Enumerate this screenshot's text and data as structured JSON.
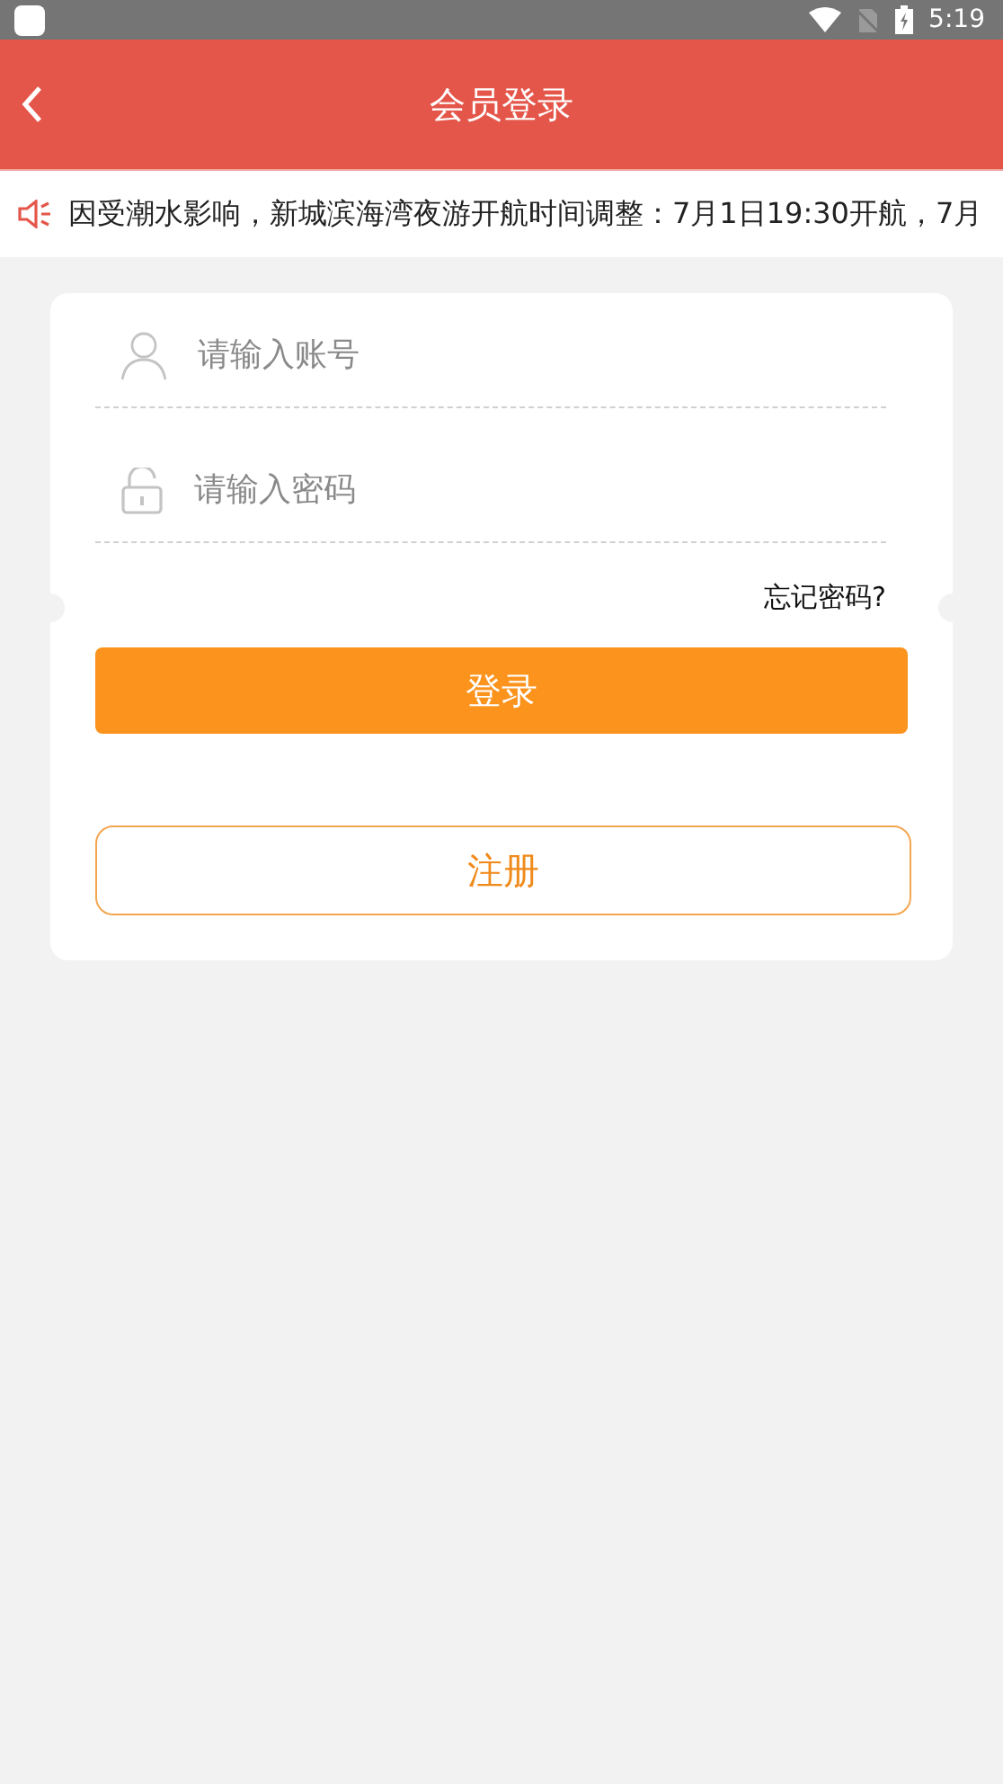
{
  "status_bar": {
    "time": "5:19"
  },
  "header": {
    "title": "会员登录"
  },
  "notice": {
    "text": "因受潮水影响，新城滨海湾夜游开航时间调整：7月1日19:30开航，7月"
  },
  "form": {
    "fields": [
      {
        "kind": "account",
        "placeholder": "请输入账号"
      },
      {
        "kind": "password",
        "placeholder": "请输入密码"
      }
    ],
    "forgot_link": "忘记密码?",
    "login_button": "登录",
    "register_button": "注册"
  }
}
